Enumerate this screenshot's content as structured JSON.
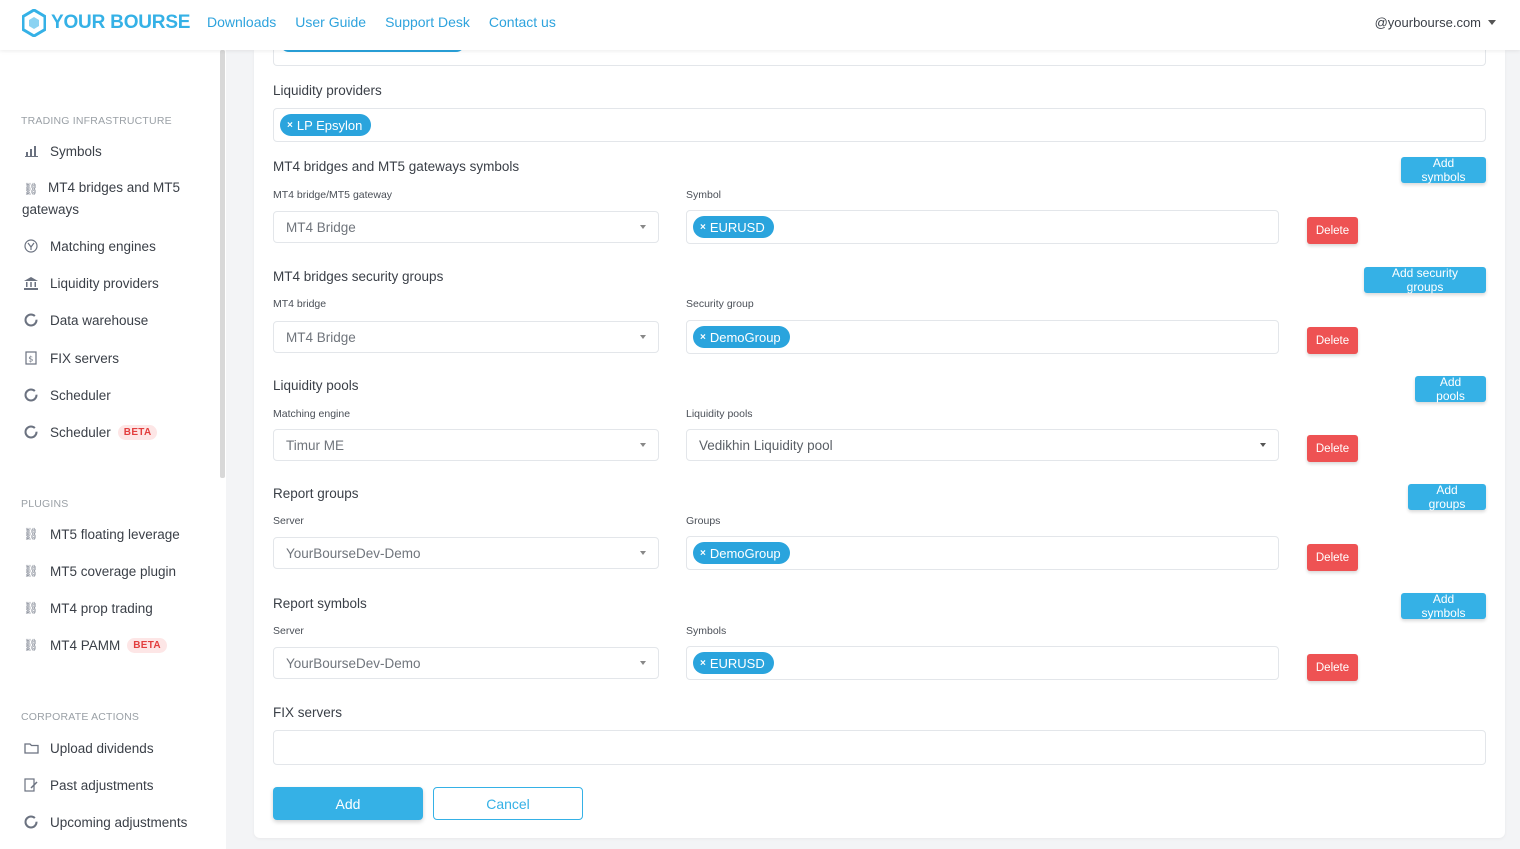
{
  "header": {
    "logo_text": "YOUR BOURSE",
    "nav": [
      "Downloads",
      "User Guide",
      "Support Desk",
      "Contact us"
    ],
    "account": "@yourbourse.com"
  },
  "sidebar": {
    "sections": [
      {
        "title": "TRADING INFRASTRUCTURE",
        "items": [
          {
            "label": "Symbols",
            "icon": "bar-chart-icon"
          },
          {
            "label": "MT4 bridges and MT5 gateways",
            "icon": "link-icon"
          },
          {
            "label": "Matching engines",
            "icon": "engine-icon"
          },
          {
            "label": "Liquidity providers",
            "icon": "bank-icon"
          },
          {
            "label": "Data warehouse",
            "icon": "circle-icon"
          },
          {
            "label": "FIX servers",
            "icon": "document-icon"
          },
          {
            "label": "Scheduler",
            "icon": "circle-icon"
          },
          {
            "label": "Scheduler",
            "icon": "circle-icon",
            "badge": "BETA"
          }
        ]
      },
      {
        "title": "PLUGINS",
        "items": [
          {
            "label": "MT5 floating leverage",
            "icon": "link-icon"
          },
          {
            "label": "MT5 coverage plugin",
            "icon": "link-icon"
          },
          {
            "label": "MT4 prop trading",
            "icon": "link-icon"
          },
          {
            "label": "MT4 PAMM",
            "icon": "link-icon",
            "badge": "BETA"
          }
        ]
      },
      {
        "title": "CORPORATE ACTIONS",
        "items": [
          {
            "label": "Upload dividends",
            "icon": "folder-icon"
          },
          {
            "label": "Past adjustments",
            "icon": "edit-icon"
          },
          {
            "label": "Upcoming adjustments",
            "icon": "circle-icon"
          }
        ]
      }
    ]
  },
  "form": {
    "liquidity_providers": {
      "label": "Liquidity providers",
      "tags": [
        "LP Epsylon"
      ]
    },
    "mt4_bridges_symbols": {
      "label": "MT4 bridges and MT5 gateways symbols",
      "add_button": "Add symbols",
      "col1_label": "MT4 bridge/MT5 gateway",
      "col1_value": "MT4 Bridge",
      "col2_label": "Symbol",
      "tags": [
        "EURUSD"
      ],
      "delete_button": "Delete"
    },
    "mt4_security_groups": {
      "label": "MT4 bridges security groups",
      "add_button": "Add security groups",
      "col1_label": "MT4 bridge",
      "col1_value": "MT4 Bridge",
      "col2_label": "Security group",
      "tags": [
        "DemoGroup"
      ],
      "delete_button": "Delete"
    },
    "liquidity_pools": {
      "label": "Liquidity pools",
      "add_button": "Add pools",
      "col1_label": "Matching engine",
      "col1_value": "Timur ME",
      "col2_label": "Liquidity pools",
      "col2_value": "Vedikhin Liquidity pool",
      "delete_button": "Delete"
    },
    "report_groups": {
      "label": "Report groups",
      "add_button": "Add groups",
      "col1_label": "Server",
      "col1_value": "YourBourseDev-Demo",
      "col2_label": "Groups",
      "tags": [
        "DemoGroup"
      ],
      "delete_button": "Delete"
    },
    "report_symbols": {
      "label": "Report symbols",
      "add_button": "Add symbols",
      "col1_label": "Server",
      "col1_value": "YourBourseDev-Demo",
      "col2_label": "Symbols",
      "tags": [
        "EURUSD"
      ],
      "delete_button": "Delete"
    },
    "fix_servers": {
      "label": "FIX servers"
    },
    "submit_label": "Add",
    "cancel_label": "Cancel"
  }
}
